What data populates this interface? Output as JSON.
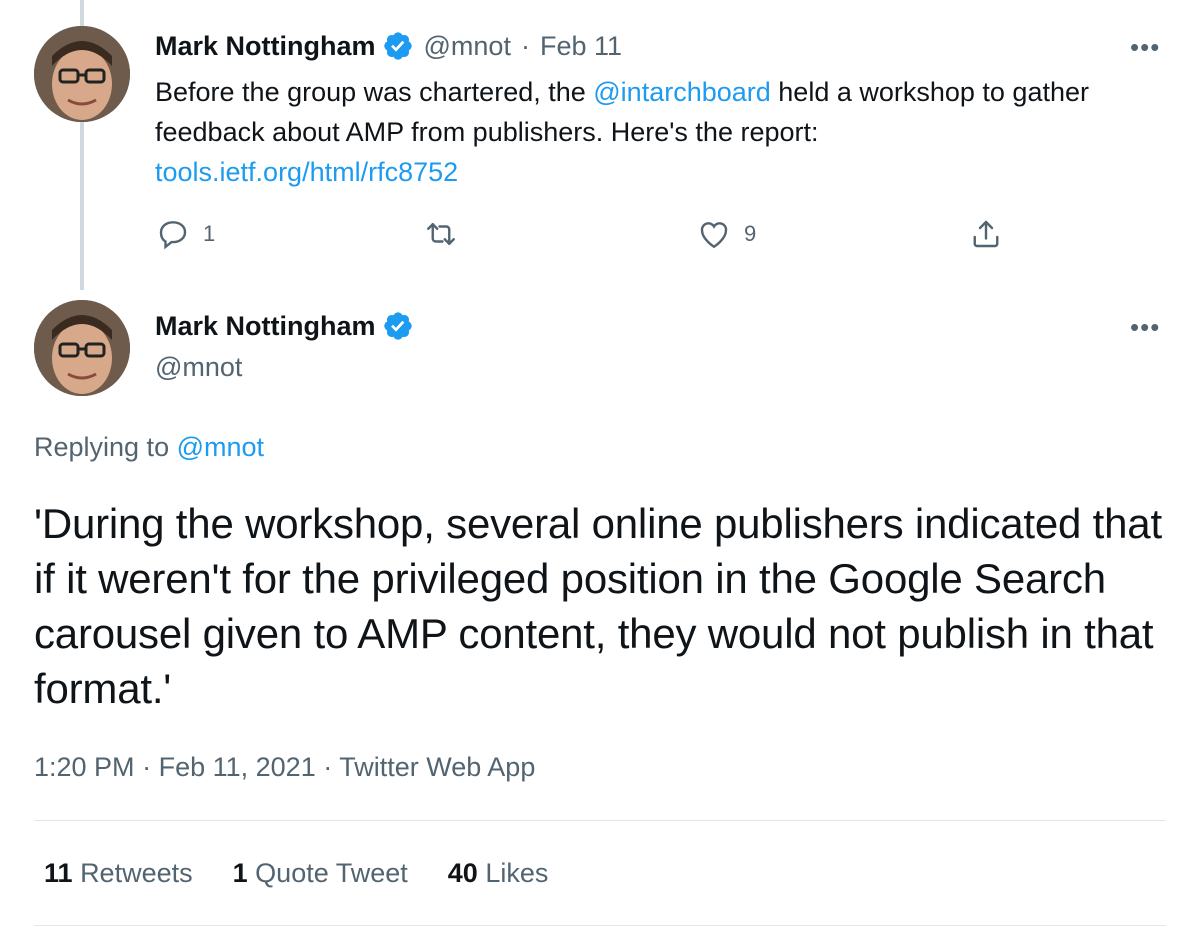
{
  "tweet1": {
    "author_name": "Mark Nottingham",
    "handle": "@mnot",
    "separator": "·",
    "date": "Feb 11",
    "more": "•••",
    "text_before": "Before the group was chartered, the ",
    "mention": "@intarchboard",
    "text_after": " held a workshop to gather feedback about AMP from publishers. Here's the report: ",
    "link": "tools.ietf.org/html/rfc8752",
    "actions": {
      "reply_count": "1",
      "like_count": "9"
    }
  },
  "tweet2": {
    "author_name": "Mark Nottingham",
    "handle": "@mnot",
    "more": "•••",
    "replying_label": "Replying to ",
    "replying_handle": "@mnot",
    "text": "'During the workshop, several online publishers indicated that if it weren't for the privileged position in the Google Search carousel given to AMP content, they would not publish in that format.'",
    "time": "1:20 PM",
    "meta_sep": "·",
    "date": "Feb 11, 2021",
    "source": "Twitter Web App"
  },
  "stats": {
    "retweets_count": "11",
    "retweets_label": "Retweets",
    "quotes_count": "1",
    "quotes_label": "Quote Tweet",
    "likes_count": "40",
    "likes_label": "Likes"
  },
  "colors": {
    "accent": "#1d9bf0",
    "muted": "#536471",
    "text": "#0f1419"
  },
  "icons": [
    "verified-badge-icon",
    "more-icon",
    "reply-icon",
    "retweet-icon",
    "like-icon",
    "share-icon"
  ]
}
